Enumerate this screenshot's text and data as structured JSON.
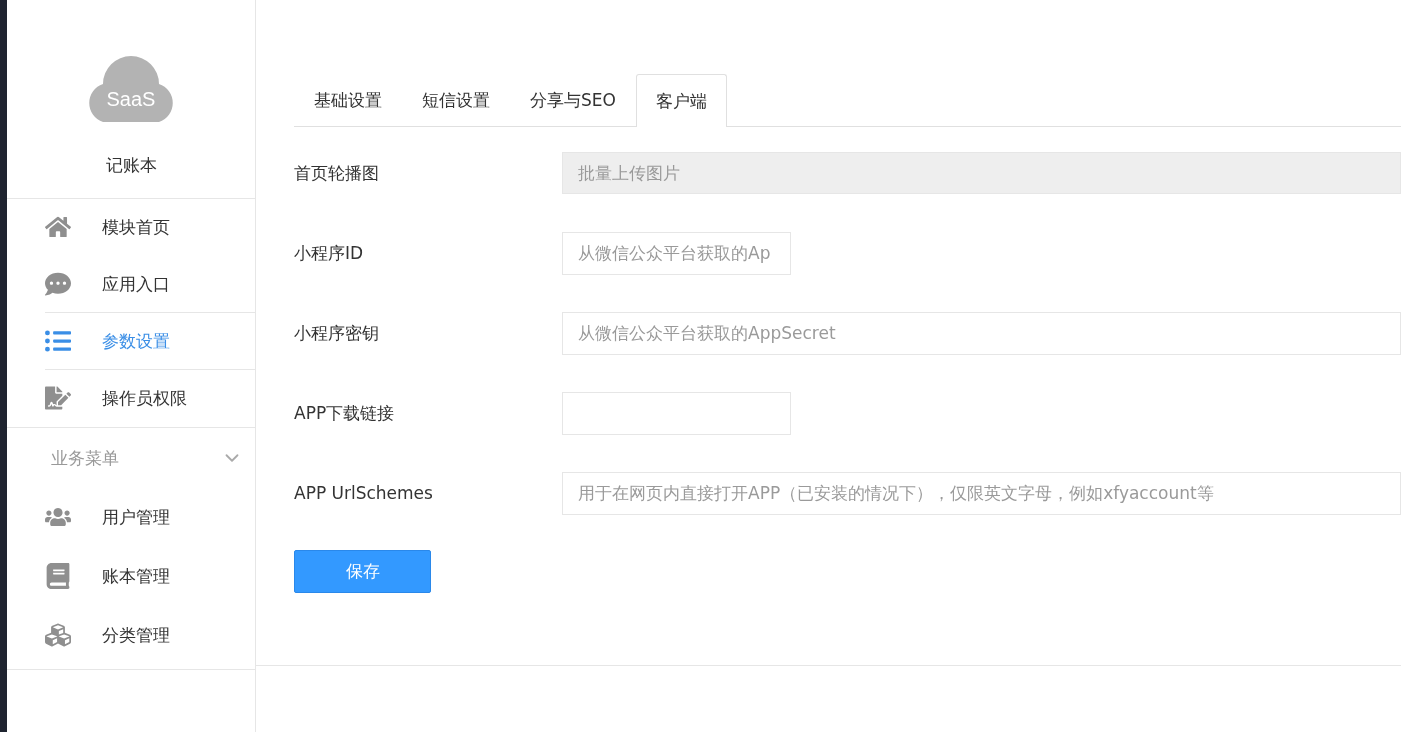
{
  "app": {
    "logo_text": "SaaS",
    "name": "记账本"
  },
  "nav": [
    {
      "label": "模块首页",
      "selected": false
    },
    {
      "label": "应用入口",
      "selected": false
    },
    {
      "label": "参数设置",
      "selected": true
    },
    {
      "label": "操作员权限",
      "selected": false
    }
  ],
  "section": {
    "title": "业务菜单",
    "expanded": true,
    "items": [
      {
        "label": "用户管理",
        "selected": false
      },
      {
        "label": "账本管理",
        "selected": false
      },
      {
        "label": "分类管理",
        "selected": false
      }
    ]
  },
  "tabs": [
    {
      "label": "基础设置",
      "selected": false
    },
    {
      "label": "短信设置",
      "selected": false
    },
    {
      "label": "分享与SEO",
      "selected": false
    },
    {
      "label": "客户端",
      "selected": true
    }
  ],
  "form": {
    "fields": [
      {
        "label": "首页轮播图",
        "kind": "upload",
        "placeholder": "批量上传图片"
      },
      {
        "label": "小程序ID",
        "kind": "short_text",
        "placeholder": "从微信公众平台获取的Ap"
      },
      {
        "label": "小程序密钥",
        "kind": "text",
        "placeholder": "从微信公众平台获取的AppSecret"
      },
      {
        "label": "APP下载链接",
        "kind": "short_text"
      },
      {
        "label": "APP UrlSchemes",
        "kind": "text",
        "placeholder": "用于在网页内直接打开APP（已安装的情况下），仅限英文字母，例如xfyaccount等"
      }
    ],
    "save_button": "保存"
  }
}
